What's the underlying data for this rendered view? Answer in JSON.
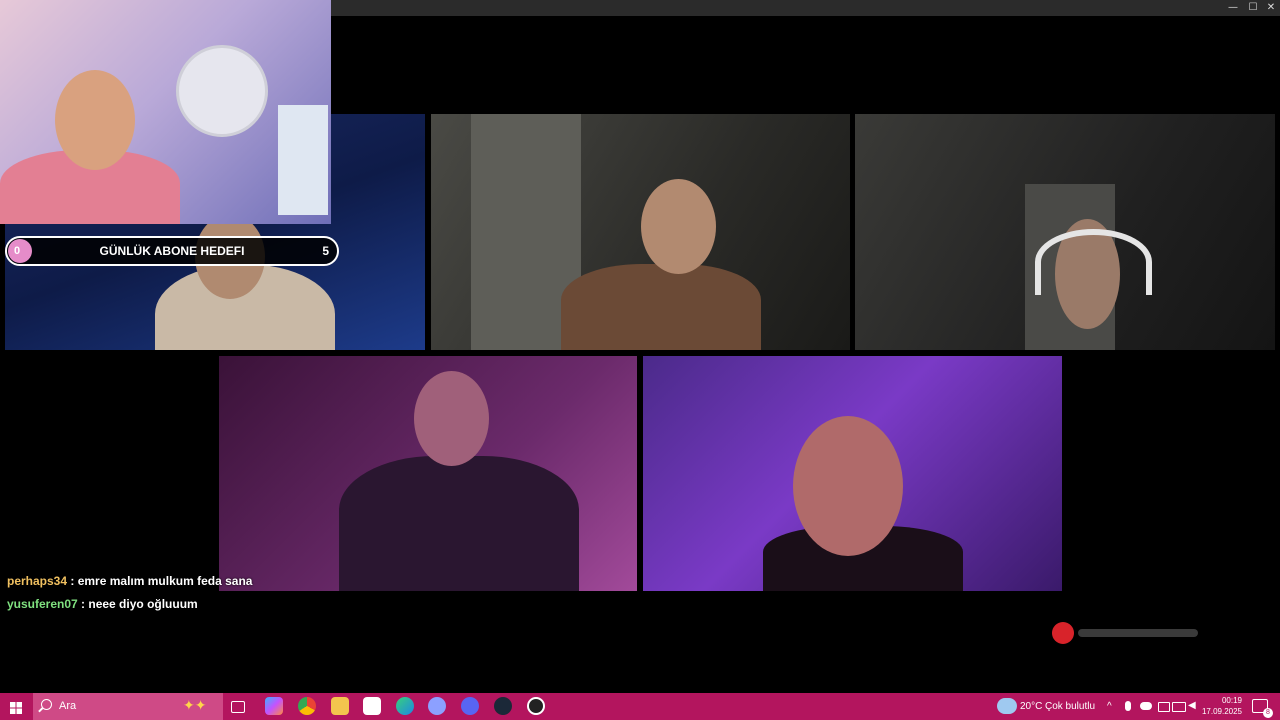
{
  "window": {
    "minimize": "—",
    "maximize": "☐",
    "close": "✕"
  },
  "goal": {
    "start": "0",
    "title": "GÜNLÜK ABONE HEDEFI",
    "end": "5"
  },
  "chat": [
    {
      "user": "perhaps34",
      "sep": " : ",
      "message": "emre malım mulkum feda sana",
      "color": "#f0c060"
    },
    {
      "user": "yusuferen07",
      "sep": " : ",
      "message": "neee diyo oğluuum",
      "color": "#7fe07f"
    }
  ],
  "taskbar": {
    "search_placeholder": "Ara",
    "weather_temp": "20°C",
    "weather_desc": "Çok bulutlu",
    "time": "00:19",
    "date": "17.09.2025",
    "notification_count": "8",
    "apps": [
      "copilot",
      "chrome",
      "file-explorer",
      "store",
      "edge",
      "game-app",
      "discord",
      "steam",
      "obs"
    ]
  },
  "colors": {
    "taskbar": "#b3155e",
    "search": "#cf4a86",
    "goal_accent": "#e58cc9"
  }
}
